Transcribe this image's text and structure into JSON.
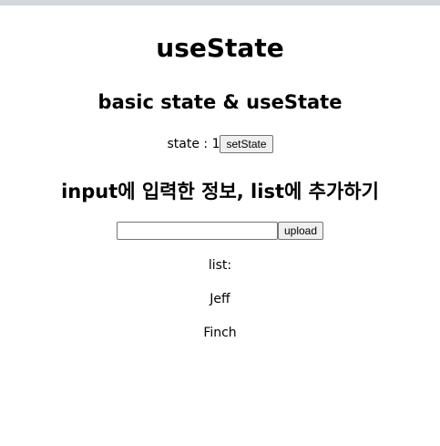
{
  "title": "useState",
  "section1": {
    "heading": "basic state & useState",
    "state_label": "state : 1",
    "button": "setState"
  },
  "section2": {
    "heading": "input에 입력한 정보, list에 추가하기",
    "input_value": "",
    "button": "upload",
    "list_label": "list:",
    "items": [
      "Jeff",
      "Finch"
    ]
  }
}
